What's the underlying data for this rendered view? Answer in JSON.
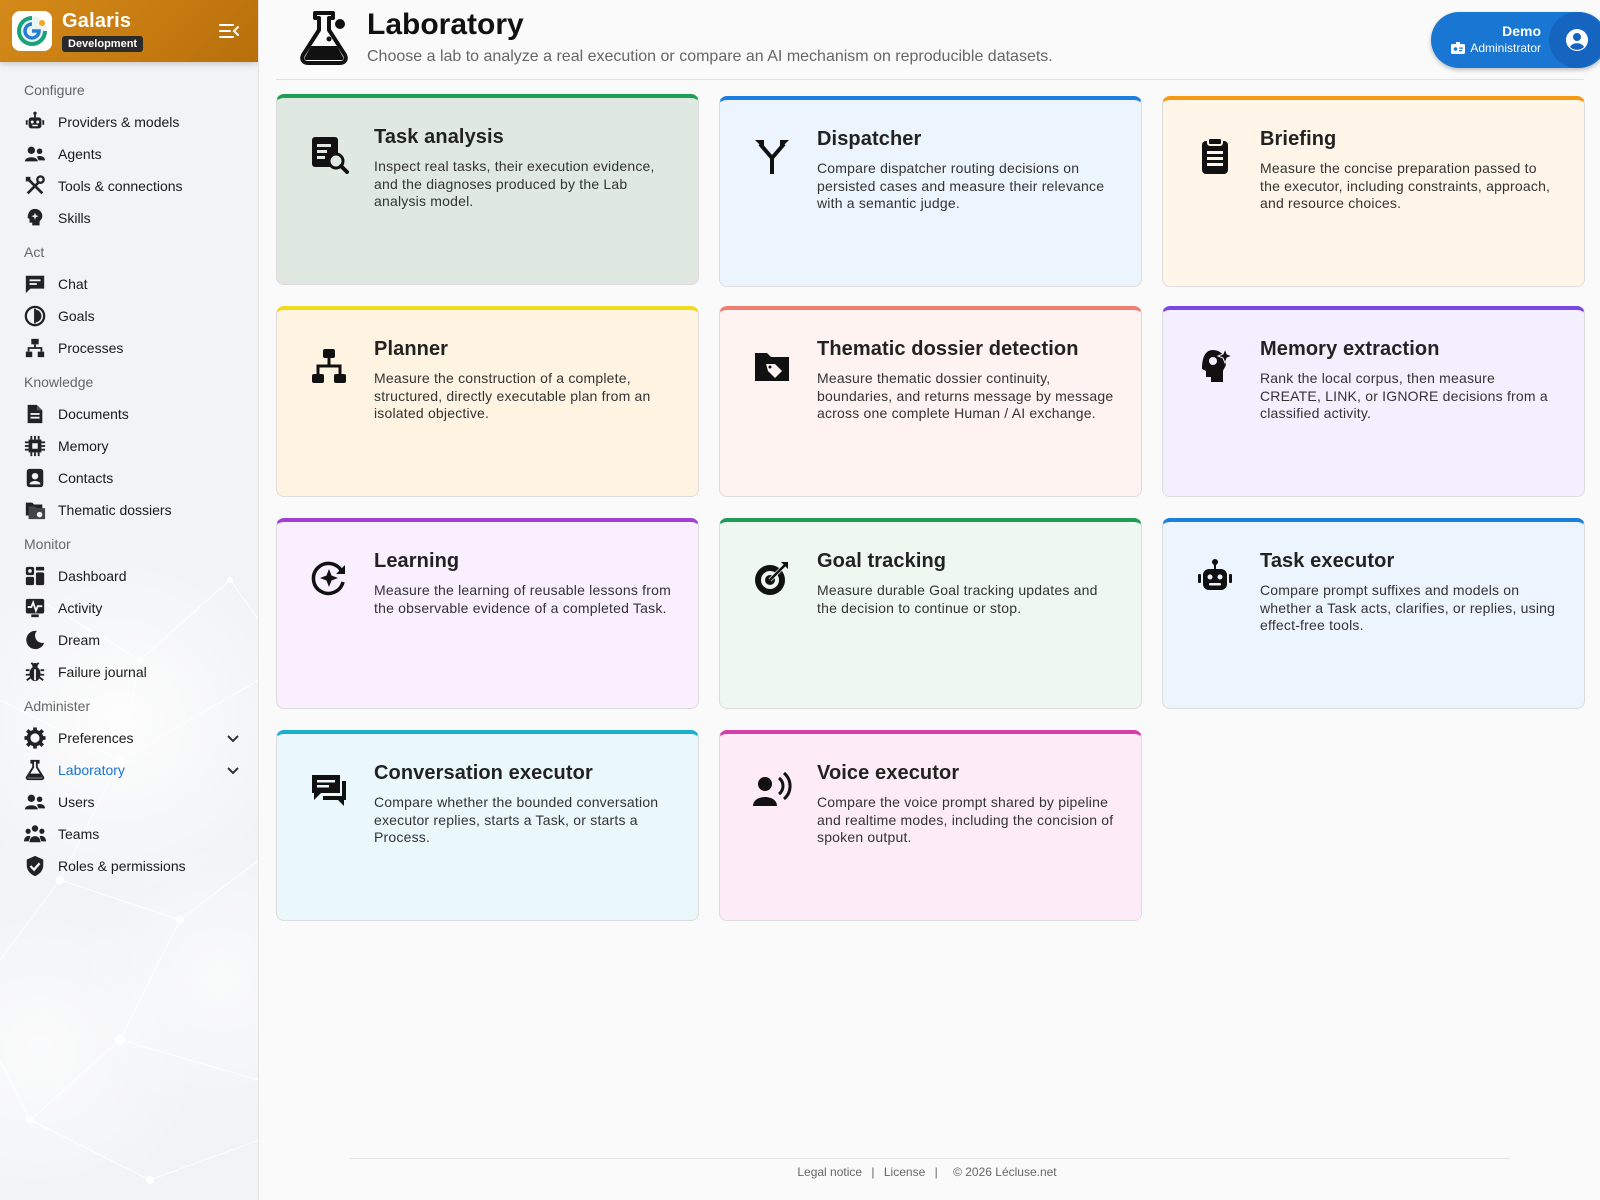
{
  "brand": {
    "name": "Galaris",
    "env_badge": "Development"
  },
  "sidebar": {
    "sections": [
      {
        "label": "Configure",
        "items": [
          {
            "label": "Providers & models",
            "icon": "robot-icon"
          },
          {
            "label": "Agents",
            "icon": "agents-icon"
          },
          {
            "label": "Tools & connections",
            "icon": "tools-icon"
          },
          {
            "label": "Skills",
            "icon": "skills-icon"
          }
        ]
      },
      {
        "label": "Act",
        "items": [
          {
            "label": "Chat",
            "icon": "chat-icon"
          },
          {
            "label": "Goals",
            "icon": "goals-icon"
          },
          {
            "label": "Processes",
            "icon": "processes-icon"
          }
        ]
      },
      {
        "label": "Knowledge",
        "items": [
          {
            "label": "Documents",
            "icon": "document-icon"
          },
          {
            "label": "Memory",
            "icon": "memory-chip-icon"
          },
          {
            "label": "Contacts",
            "icon": "contacts-icon"
          },
          {
            "label": "Thematic dossiers",
            "icon": "folders-icon"
          }
        ]
      },
      {
        "label": "Monitor",
        "items": [
          {
            "label": "Dashboard",
            "icon": "dashboard-icon"
          },
          {
            "label": "Activity",
            "icon": "activity-icon"
          },
          {
            "label": "Dream",
            "icon": "moon-icon"
          },
          {
            "label": "Failure journal",
            "icon": "bug-icon"
          }
        ]
      },
      {
        "label": "Administer",
        "items": [
          {
            "label": "Preferences",
            "icon": "gear-icon",
            "expandable": true
          },
          {
            "label": "Laboratory",
            "icon": "flask-icon",
            "expandable": true,
            "active": true
          },
          {
            "label": "Users",
            "icon": "users-icon"
          },
          {
            "label": "Teams",
            "icon": "teams-icon"
          },
          {
            "label": "Roles & permissions",
            "icon": "shield-icon"
          }
        ]
      }
    ]
  },
  "header": {
    "title": "Laboratory",
    "subtitle": "Choose a lab to analyze a real execution or compare an AI mechanism on reproducible datasets."
  },
  "user": {
    "name": "Demo",
    "role": "Administrator"
  },
  "cards": [
    {
      "title": "Task analysis",
      "description": "Inspect real tasks, their execution evidence, and the diagnoses produced by the Lab analysis model.",
      "icon": "task-search-icon",
      "accent": "#1e9e55",
      "bg": "#dfe9e2"
    },
    {
      "title": "Dispatcher",
      "description": "Compare dispatcher routing decisions on persisted cases and measure their relevance with a semantic judge.",
      "icon": "split-arrow-icon",
      "accent": "#1a7fe0",
      "bg": "#ecf5fd"
    },
    {
      "title": "Briefing",
      "description": "Measure the concise preparation passed to the executor, including constraints, approach, and resource choices.",
      "icon": "clipboard-icon",
      "accent": "#f59a12",
      "bg": "#fff6e9"
    },
    {
      "title": "Planner",
      "description": "Measure the construction of a complete, structured, directly executable plan from an isolated objective.",
      "icon": "hierarchy-icon",
      "accent": "#f1d91c",
      "bg": "#fff4e1"
    },
    {
      "title": "Thematic dossier detection",
      "description": "Measure thematic dossier continuity, boundaries, and returns message by message across one complete Human / AI exchange.",
      "icon": "folder-tag-icon",
      "accent": "#f07d72",
      "bg": "#fff3f1"
    },
    {
      "title": "Memory extraction",
      "description": "Rank the local corpus, then measure CREATE, LINK, or IGNORE decisions from a classified activity.",
      "icon": "brain-head-icon",
      "accent": "#7a48e0",
      "bg": "#f4efff"
    },
    {
      "title": "Learning",
      "description": "Measure the learning of reusable lessons from the observable evidence of a completed Task.",
      "icon": "learning-cycle-icon",
      "accent": "#a23fd6",
      "bg": "#f9efff"
    },
    {
      "title": "Goal tracking",
      "description": "Measure durable Goal tracking updates and the decision to continue or stop.",
      "icon": "target-icon",
      "accent": "#1e9e55",
      "bg": "#eef8f1"
    },
    {
      "title": "Task executor",
      "description": "Compare prompt suffixes and models on whether a Task acts, clarifies, or replies, using effect-free tools.",
      "icon": "robot-icon",
      "accent": "#1a7fe0",
      "bg": "#ecf5fd"
    },
    {
      "title": "Conversation executor",
      "description": "Compare whether the bounded conversation executor replies, starts a Task, or starts a Process.",
      "icon": "chat-bubbles-icon",
      "accent": "#1bb1cc",
      "bg": "#eaf8fc"
    },
    {
      "title": "Voice executor",
      "description": "Compare the voice prompt shared by pipeline and realtime modes, including the concision of spoken output.",
      "icon": "voice-icon",
      "accent": "#d63fa8",
      "bg": "#fdecf7"
    }
  ],
  "footer": {
    "legal": "Legal notice",
    "license": "License",
    "copyright": "© 2026 Lécluse.net",
    "separator": "|"
  }
}
